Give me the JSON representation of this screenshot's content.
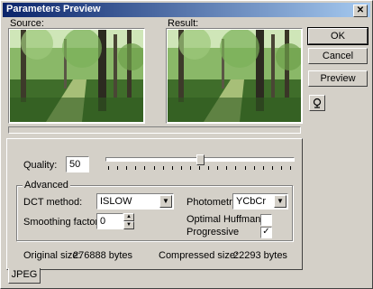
{
  "window": {
    "title": "Parameters Preview",
    "close_glyph": "✕"
  },
  "preview": {
    "source_label": "Source:",
    "result_label": "Result:"
  },
  "buttons": {
    "ok": "OK",
    "cancel": "Cancel",
    "preview": "Preview"
  },
  "quality": {
    "label": "Quality:",
    "value": "50",
    "slider_level": 0.5
  },
  "advanced": {
    "title": "Advanced",
    "dct_method_label": "DCT method:",
    "dct_method_value": "ISLOW",
    "smoothing_label": "Smoothing factor:",
    "smoothing_value": "0",
    "photometric_label": "Photometric:",
    "photometric_value": "YCbCr",
    "optimal_huffman_label": "Optimal Huffman",
    "optimal_huffman_checked": false,
    "progressive_label": "Progressive",
    "progressive_checked": true
  },
  "sizes": {
    "original_label": "Original size:",
    "original_value": "276888 bytes",
    "compressed_label": "Compressed size:",
    "compressed_value": "22293 bytes"
  },
  "tabs": {
    "jpeg": "JPEG"
  },
  "icons": {
    "tool_button": "lens-icon"
  }
}
